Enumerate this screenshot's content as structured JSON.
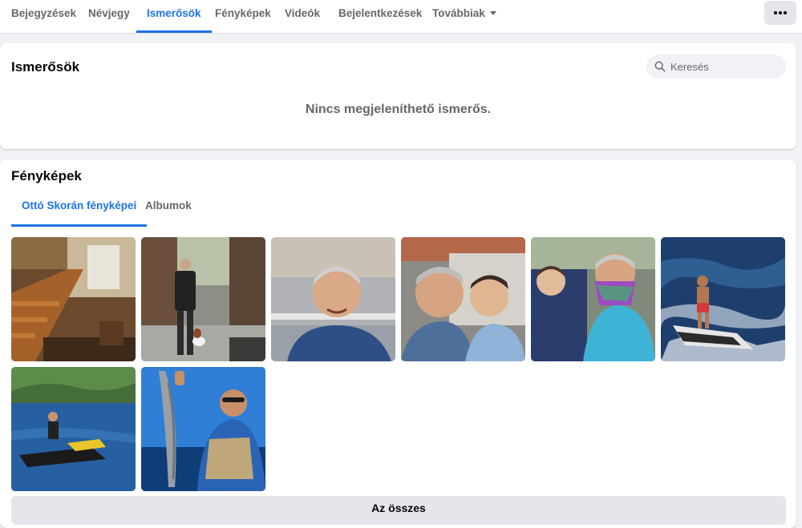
{
  "nav": {
    "tabs": [
      {
        "label": "Bejegyzések"
      },
      {
        "label": "Névjegy"
      },
      {
        "label": "Ismerősök"
      },
      {
        "label": "Fényképek"
      },
      {
        "label": "Videók"
      },
      {
        "label": "Bejelentkezések"
      },
      {
        "label": "Továbbiak"
      }
    ],
    "active_tab": "Ismerősök",
    "more_icon": "ellipsis-icon"
  },
  "friends": {
    "title": "Ismerősök",
    "search_placeholder": "Keresés",
    "search_value": "",
    "empty_message": "Nincs megjeleníthető ismerős."
  },
  "photos": {
    "title": "Fényképek",
    "tabs": [
      {
        "label": "Ottó Skorán fényképei"
      },
      {
        "label": "Albumok"
      }
    ],
    "active_tab": "Ottó Skorán fényképei",
    "see_all_label": "Az összes"
  },
  "colors": {
    "accent": "#1b74e4",
    "background": "#f0f2f5",
    "secondary_text": "#65676b"
  }
}
